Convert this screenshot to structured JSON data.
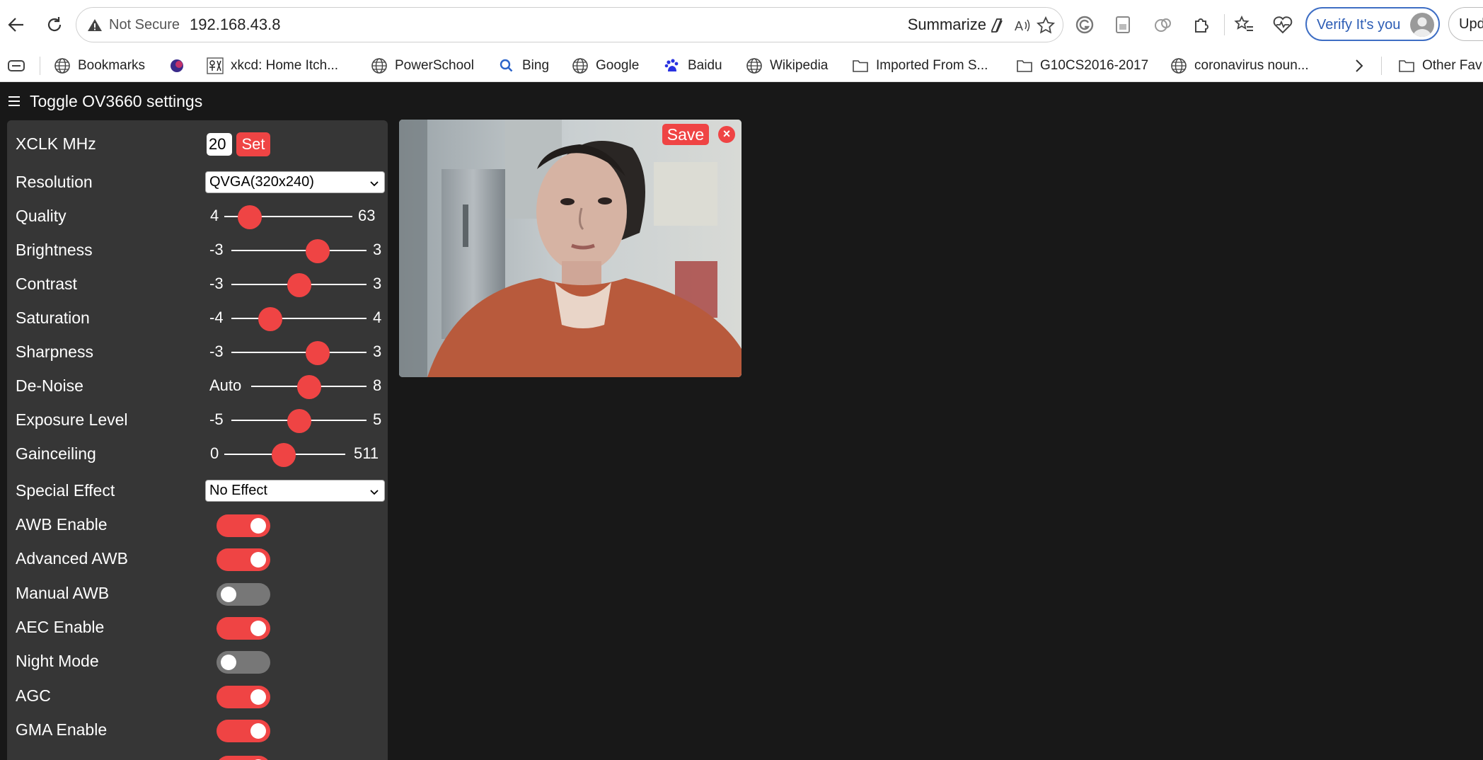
{
  "browser": {
    "address_security": "Not Secure",
    "url": "192.168.43.8",
    "summarize_label": "Summarize",
    "verify_label": "Verify It's you",
    "update_label": "Upda"
  },
  "bookmarks": [
    {
      "label": "Bookmarks",
      "icon": "globe-icon"
    },
    {
      "label": "",
      "icon": "favicon"
    },
    {
      "label": "xkcd: Home Itch...",
      "icon": "xkcd-favicon"
    },
    {
      "label": "PowerSchool",
      "icon": "globe-icon"
    },
    {
      "label": "Bing",
      "icon": "search-icon"
    },
    {
      "label": "Google",
      "icon": "globe-icon"
    },
    {
      "label": "Baidu",
      "icon": "baidu-icon"
    },
    {
      "label": "Wikipedia",
      "icon": "globe-icon"
    },
    {
      "label": "Imported From S...",
      "icon": "folder-icon"
    },
    {
      "label": "G10CS2016-2017",
      "icon": "folder-icon"
    },
    {
      "label": "coronavirus noun...",
      "icon": "globe-icon"
    },
    {
      "label": "Other Fav",
      "icon": "folder-icon"
    }
  ],
  "menu": {
    "title": "Toggle OV3660 settings"
  },
  "settings": {
    "xclk": {
      "label": "XCLK MHz",
      "value": "20",
      "button": "Set"
    },
    "resolution": {
      "label": "Resolution",
      "value": "QVGA(320x240)"
    },
    "sliders": [
      {
        "label": "Quality",
        "min": "4",
        "max": "63",
        "fraction": 0.2
      },
      {
        "label": "Brightness",
        "min": "-3",
        "max": "3",
        "fraction": 0.64
      },
      {
        "label": "Contrast",
        "min": "-3",
        "max": "3",
        "fraction": 0.5
      },
      {
        "label": "Saturation",
        "min": "-4",
        "max": "4",
        "fraction": 0.29
      },
      {
        "label": "Sharpness",
        "min": "-3",
        "max": "3",
        "fraction": 0.64
      },
      {
        "label": "De-Noise",
        "min": "Auto",
        "max": "8",
        "fraction": 0.5
      },
      {
        "label": "Exposure Level",
        "min": "-5",
        "max": "5",
        "fraction": 0.5
      },
      {
        "label": "Gainceiling",
        "min": "0",
        "max": "511",
        "fraction": 0.49
      }
    ],
    "special_effect": {
      "label": "Special Effect",
      "value": "No Effect"
    },
    "toggles": [
      {
        "label": "AWB Enable",
        "on": true
      },
      {
        "label": "Advanced AWB",
        "on": true
      },
      {
        "label": "Manual AWB",
        "on": false
      },
      {
        "label": "AEC Enable",
        "on": true
      },
      {
        "label": "Night Mode",
        "on": false
      },
      {
        "label": "AGC",
        "on": true
      },
      {
        "label": "GMA Enable",
        "on": true
      }
    ]
  },
  "stream": {
    "save_label": "Save",
    "close_label": "×"
  },
  "colors": {
    "accent": "#ef4444",
    "page_bg": "#181818",
    "panel_bg": "#363636"
  }
}
